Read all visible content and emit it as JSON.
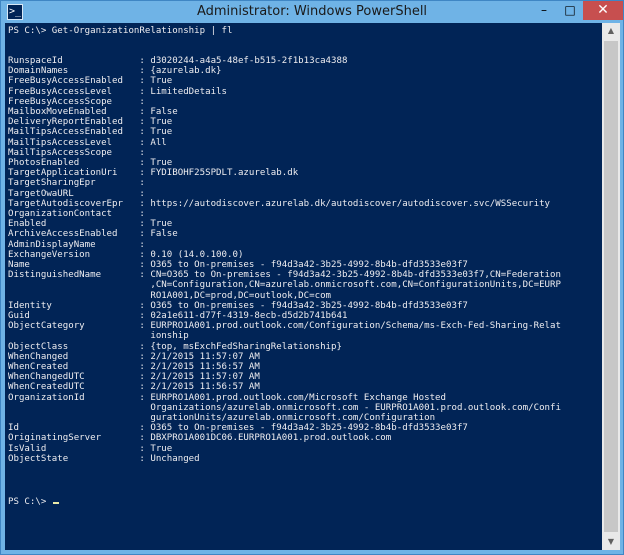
{
  "window": {
    "title": "Administrator: Windows PowerShell",
    "icon_glyph": ">_",
    "controls": {
      "minimize": "–",
      "maximize": "□",
      "close": "✕"
    }
  },
  "colors": {
    "console_bg": "#012456",
    "console_text": "#eeedf0",
    "titlebar": "#6fb3e6",
    "close_button": "#c74f4f"
  },
  "console": {
    "command_line": "PS C:\\> Get-OrganizationRelationship | fl",
    "lines": [
      "RunspaceId              : d3020244-a4a5-48ef-b515-2f1b13ca4388",
      "DomainNames             : {azurelab.dk}",
      "FreeBusyAccessEnabled   : True",
      "FreeBusyAccessLevel     : LimitedDetails",
      "FreeBusyAccessScope     :",
      "MailboxMoveEnabled      : False",
      "DeliveryReportEnabled   : True",
      "MailTipsAccessEnabled   : True",
      "MailTipsAccessLevel     : All",
      "MailTipsAccessScope     :",
      "PhotosEnabled           : True",
      "TargetApplicationUri    : FYDIBOHF25SPDLT.azurelab.dk",
      "TargetSharingEpr        :",
      "TargetOwaURL            :",
      "TargetAutodiscoverEpr   : https://autodiscover.azurelab.dk/autodiscover/autodiscover.svc/WSSecurity",
      "OrganizationContact     :",
      "Enabled                 : True",
      "ArchiveAccessEnabled    : False",
      "AdminDisplayName        :",
      "ExchangeVersion         : 0.10 (14.0.100.0)",
      "Name                    : O365 to On-premises - f94d3a42-3b25-4992-8b4b-dfd3533e03f7",
      "DistinguishedName       : CN=O365 to On-premises - f94d3a42-3b25-4992-8b4b-dfd3533e03f7,CN=Federation",
      "                          ,CN=Configuration,CN=azurelab.onmicrosoft.com,CN=ConfigurationUnits,DC=EURP",
      "                          RO1A001,DC=prod,DC=outlook,DC=com",
      "Identity                : O365 to On-premises - f94d3a42-3b25-4992-8b4b-dfd3533e03f7",
      "Guid                    : 02a1e611-d77f-4319-8ecb-d5d2b741b641",
      "ObjectCategory          : EURPRO1A001.prod.outlook.com/Configuration/Schema/ms-Exch-Fed-Sharing-Relat",
      "                          ionship",
      "ObjectClass             : {top, msExchFedSharingRelationship}",
      "WhenChanged             : 2/1/2015 11:57:07 AM",
      "WhenCreated             : 2/1/2015 11:56:57 AM",
      "WhenChangedUTC          : 2/1/2015 11:57:07 AM",
      "WhenCreatedUTC          : 2/1/2015 11:56:57 AM",
      "OrganizationId          : EURPRO1A001.prod.outlook.com/Microsoft Exchange Hosted",
      "                          Organizations/azurelab.onmicrosoft.com - EURPRO1A001.prod.outlook.com/Confi",
      "                          gurationUnits/azurelab.onmicrosoft.com/Configuration",
      "Id                      : O365 to On-premises - f94d3a42-3b25-4992-8b4b-dfd3533e03f7",
      "OriginatingServer       : DBXPRO1A001DC06.EURPRO1A001.prod.outlook.com",
      "IsValid                 : True",
      "ObjectState             : Unchanged"
    ],
    "prompt": "PS C:\\> "
  },
  "scrollbar": {
    "up_icon": "▲",
    "down_icon": "▼"
  }
}
